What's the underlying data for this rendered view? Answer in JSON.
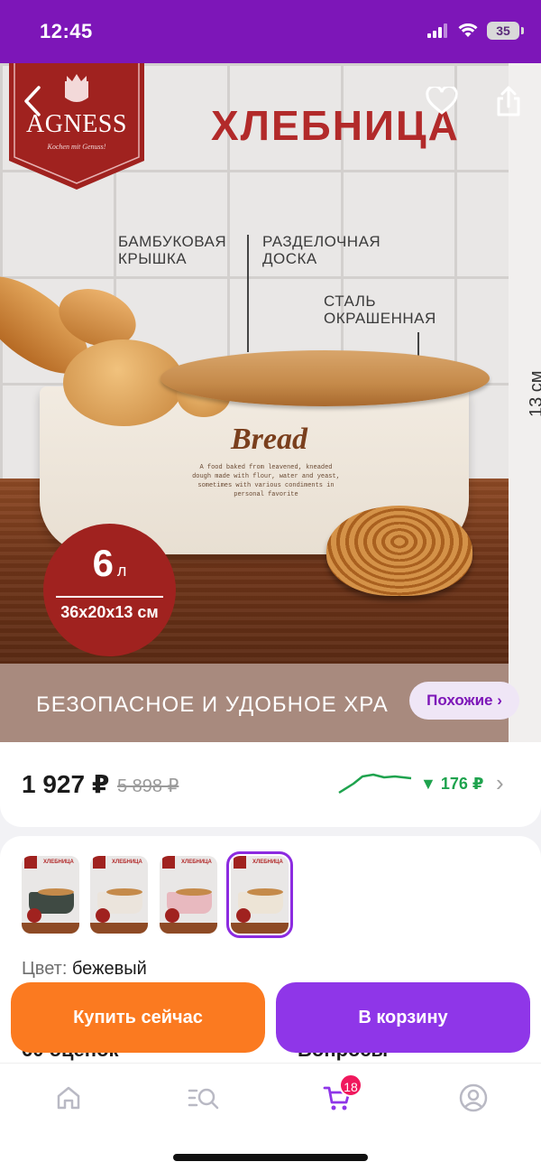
{
  "status": {
    "time": "12:45",
    "battery": "35"
  },
  "hero": {
    "brand": "AGNESS",
    "brand_tagline": "Kochen mit Genuss!",
    "title": "ХЛЕБНИЦА",
    "callouts": [
      {
        "line1": "БАМБУКОВАЯ",
        "line2": "КРЫШКА"
      },
      {
        "line1": "РАЗДЕЛОЧНАЯ",
        "line2": "ДОСКА"
      },
      {
        "line1": "СТАЛЬ",
        "line2": "ОКРАШЕННАЯ"
      }
    ],
    "box_word": "Bread",
    "box_desc": "A food baked from leavened, kneaded dough made with flour, water and yeast, sometimes with various condiments in personal favorite",
    "volume": "6",
    "volume_unit": "л",
    "dimensions": "36x20x13 см",
    "side_dimension": "13 см",
    "band_text": "БЕЗОПАСНОЕ И УДОБНОЕ ХРА",
    "similar_label": "Похожие ›"
  },
  "price": {
    "current": "1 927 ₽",
    "old": "5 898 ₽",
    "drop": "▼ 176 ₽"
  },
  "variants": {
    "thumb_title": "ХЛЕБНИЦА",
    "items": [
      {
        "color": "#3f4a43",
        "name": "dark green"
      },
      {
        "color": "#ebe4dc",
        "name": "white"
      },
      {
        "color": "#e8b9bf",
        "name": "pink"
      },
      {
        "color": "#ede4d6",
        "name": "beige"
      }
    ],
    "color_key": "Цвет:",
    "color_value": "бежевый"
  },
  "actions": {
    "buy_now": "Купить сейчас",
    "add_to_cart": "В корзину"
  },
  "peek": {
    "reviews": "60 оценок",
    "questions": "Вопросы"
  },
  "tabbar": {
    "cart_count": "18"
  },
  "colors": {
    "accent": "#7d16b8",
    "buy": "#fb7a20",
    "cart": "#8f36e8",
    "price_drop": "#1fa34e"
  }
}
